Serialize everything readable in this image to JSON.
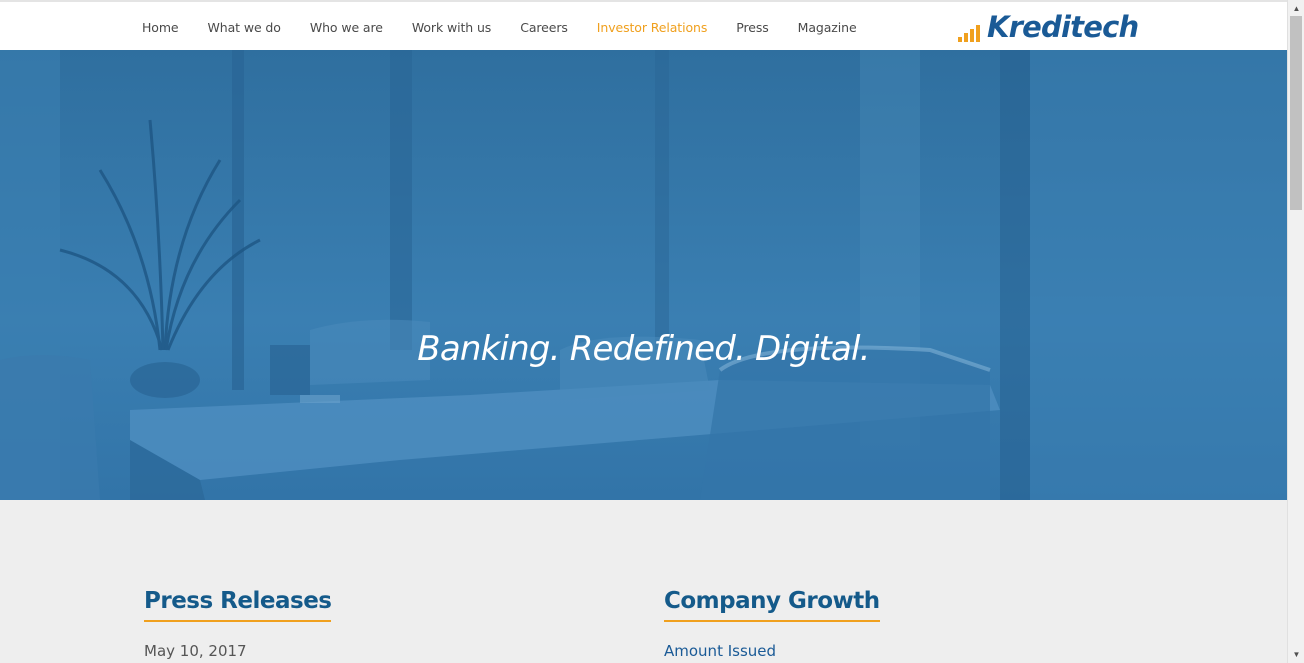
{
  "nav": {
    "items": [
      {
        "label": "Home"
      },
      {
        "label": "What we do"
      },
      {
        "label": "Who we are"
      },
      {
        "label": "Work with us"
      },
      {
        "label": "Careers"
      },
      {
        "label": "Investor Relations",
        "active": true
      },
      {
        "label": "Press"
      },
      {
        "label": "Magazine"
      }
    ]
  },
  "logo": {
    "text": "Kreditech",
    "icon": "signal-bars-icon"
  },
  "hero": {
    "title": "Banking. Redefined. Digital."
  },
  "press": {
    "heading": "Press Releases",
    "first_date": "May 10, 2017"
  },
  "growth": {
    "heading": "Company Growth",
    "first_item": "Amount Issued"
  },
  "colors": {
    "accent": "#f0a01e",
    "brand": "#1a5a96",
    "hero_overlay": "#2f72a4"
  }
}
